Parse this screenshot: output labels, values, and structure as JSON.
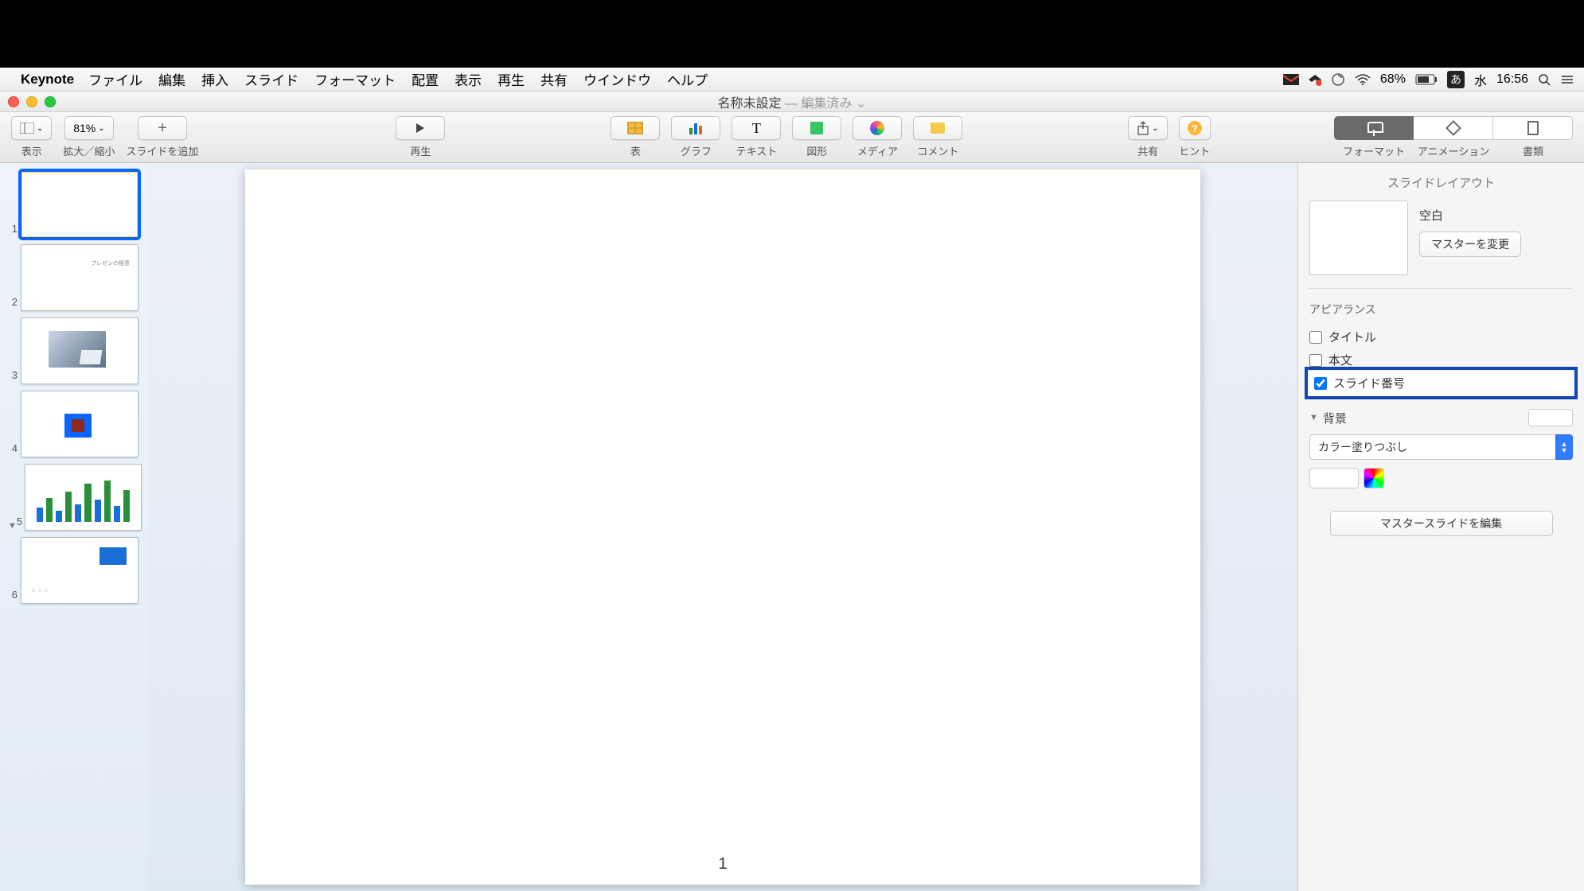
{
  "menubar": {
    "app": "Keynote",
    "items": [
      "ファイル",
      "編集",
      "挿入",
      "スライド",
      "フォーマット",
      "配置",
      "表示",
      "再生",
      "共有",
      "ウインドウ",
      "ヘルプ"
    ],
    "battery": "68%",
    "ime": "あ",
    "day": "水",
    "time": "16:56"
  },
  "window": {
    "title": "名称未設定",
    "subtitle": "編集済み"
  },
  "toolbar": {
    "view_label": "表示",
    "zoom": "81%",
    "zoom_label": "拡大／縮小",
    "add_slide": "スライドを追加",
    "play": "再生",
    "table": "表",
    "chart": "グラフ",
    "text": "テキスト",
    "shape": "図形",
    "media": "メディア",
    "comment": "コメント",
    "share": "共有",
    "hint": "ヒント",
    "format": "フォーマット",
    "animation": "アニメーション",
    "document": "書類"
  },
  "slides": {
    "count": 6,
    "selected": 1,
    "canvas_number": "1"
  },
  "inspector": {
    "header": "スライドレイアウト",
    "layout_name": "空白",
    "change_master": "マスターを変更",
    "appearance": "アピアランス",
    "title_cb": "タイトル",
    "body_cb": "本文",
    "slidenum_cb": "スライド番号",
    "background": "背景",
    "fill_type": "カラー塗りつぶし",
    "edit_master": "マスタースライドを編集"
  }
}
